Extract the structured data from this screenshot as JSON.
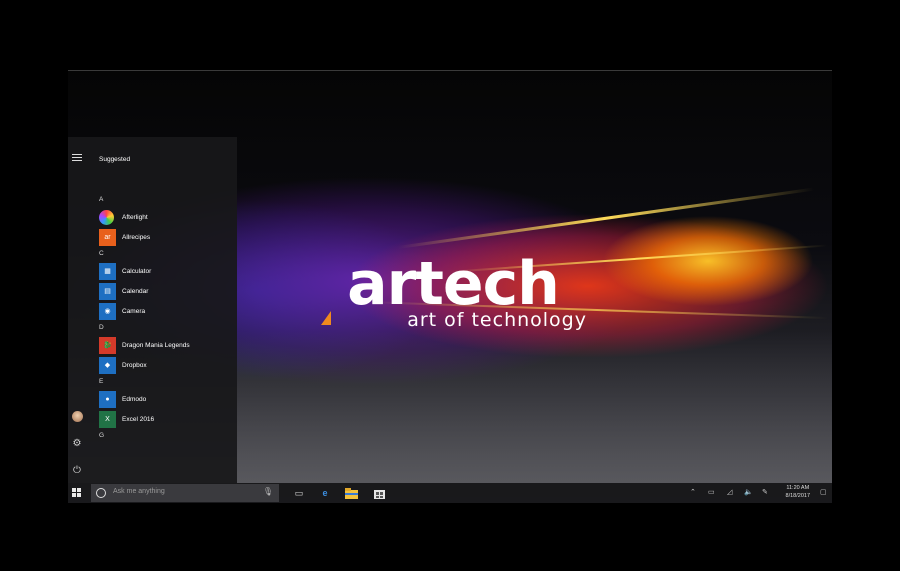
{
  "brand": {
    "logo_text": "artech",
    "tagline": "art of technology"
  },
  "start_menu": {
    "header": "Suggested",
    "sections": [
      {
        "letter": "A",
        "apps": [
          {
            "label": "Afterlight",
            "icon": "afterlight-icon",
            "color": "#ffffff"
          },
          {
            "label": "Allrecipes",
            "icon": "allrecipes-icon",
            "color": "#e8601c"
          }
        ]
      },
      {
        "letter": "C",
        "apps": [
          {
            "label": "Calculator",
            "icon": "calculator-icon",
            "color": "#1e6fc2"
          },
          {
            "label": "Calendar",
            "icon": "calendar-icon",
            "color": "#1e6fc2"
          },
          {
            "label": "Camera",
            "icon": "camera-icon",
            "color": "#1e6fc2"
          }
        ]
      },
      {
        "letter": "D",
        "apps": [
          {
            "label": "Dragon Mania Legends",
            "icon": "dragon-mania-icon",
            "color": "#d43a2a"
          },
          {
            "label": "Dropbox",
            "icon": "dropbox-icon",
            "color": "#1e6fc2"
          }
        ]
      },
      {
        "letter": "E",
        "apps": [
          {
            "label": "Edmodo",
            "icon": "edmodo-icon",
            "color": "#1e6fc2"
          },
          {
            "label": "Excel 2016",
            "icon": "excel-icon",
            "color": "#217346"
          }
        ]
      },
      {
        "letter": "G",
        "apps": []
      }
    ]
  },
  "taskbar": {
    "search_placeholder": "Ask me anything",
    "time": "11:20 AM",
    "date": "8/18/2017"
  },
  "colors": {
    "accent": "#1e6fc2",
    "logo_mark": "#f08a1e"
  }
}
